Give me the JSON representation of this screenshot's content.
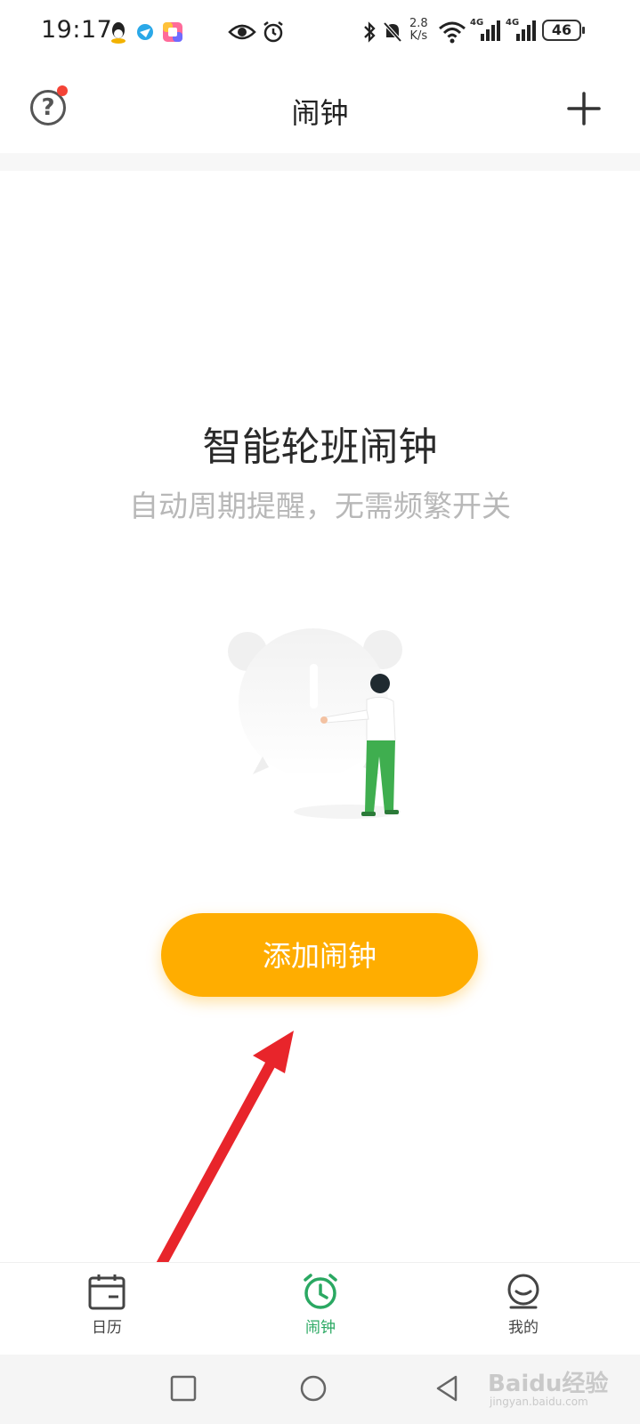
{
  "status_bar": {
    "time": "19:17",
    "net_speed_value": "2.8",
    "net_speed_unit": "K/s",
    "battery": "46",
    "signal_label_1": "4G",
    "signal_label_2": "4G"
  },
  "header": {
    "title": "闹钟",
    "help_glyph": "?"
  },
  "empty_state": {
    "title": "智能轮班闹钟",
    "subtitle": "自动周期提醒，无需频繁开关",
    "add_button_label": "添加闹钟"
  },
  "nav": {
    "items": [
      {
        "label": "日历",
        "icon": "calendar-icon",
        "active": false
      },
      {
        "label": "闹钟",
        "icon": "alarm-clock-icon",
        "active": true
      },
      {
        "label": "我的",
        "icon": "profile-icon",
        "active": false
      }
    ]
  },
  "colors": {
    "accent": "#ffad00",
    "active_nav": "#2aa862",
    "badge": "#f44336",
    "annotation_arrow": "#e8252b"
  },
  "watermark": {
    "brand": "Baidu经验",
    "url": "jingyan.baidu.com"
  }
}
